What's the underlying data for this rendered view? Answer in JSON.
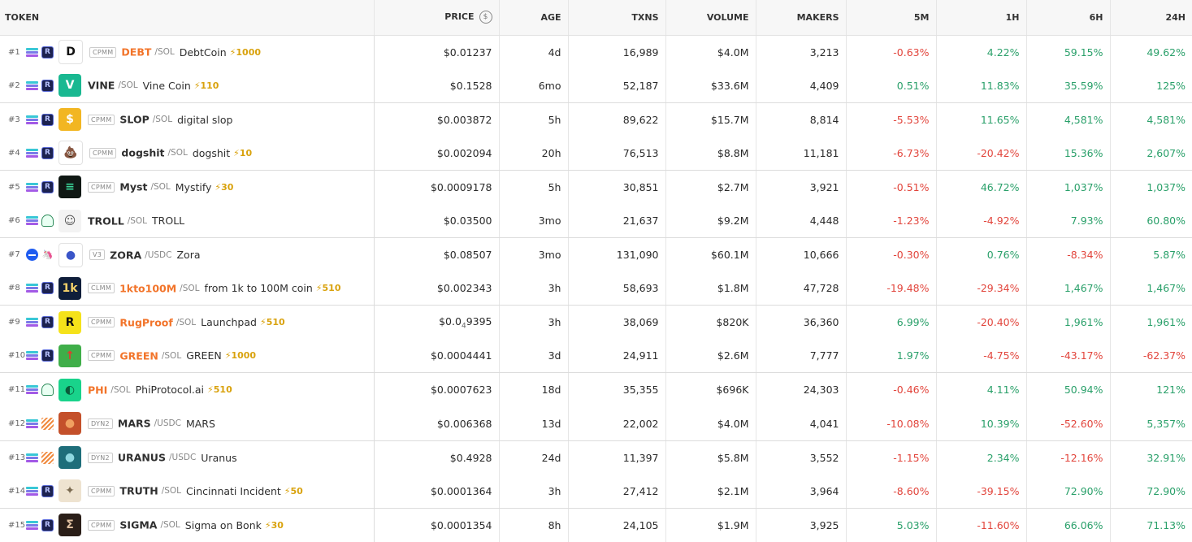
{
  "header": {
    "token": "TOKEN",
    "price": "PRICE",
    "price_icon": "$",
    "age": "AGE",
    "txns": "TXNS",
    "volume": "VOLUME",
    "makers": "MAKERS",
    "m5": "5M",
    "h1": "1H",
    "h6": "6H",
    "h24": "24H"
  },
  "colors": {
    "positive": "#2aa06a",
    "negative": "#e2453c",
    "boost": "#d9a20d",
    "highlight_symbol": "#f2742a"
  },
  "rows": [
    {
      "rank": "#1",
      "chain": "solana-icon",
      "dex": "raydium-icon",
      "icon": {
        "name": "debtcoin-logo",
        "glyph": "D",
        "bg": "#ffffff",
        "fg": "#111111"
      },
      "tag": "CPMM",
      "symbol": "DEBT",
      "symbol_highlight": true,
      "quote": "/SOL",
      "name": "DebtCoin",
      "boost": "⚡1000",
      "price": "$0.01237",
      "age": "4d",
      "txns": "16,989",
      "volume": "$4.0M",
      "makers": "3,213",
      "m5": "-0.63%",
      "h1": "4.22%",
      "h6": "59.15%",
      "h24": "49.62%"
    },
    {
      "rank": "#2",
      "chain": "solana-icon",
      "dex": "raydium-icon",
      "icon": {
        "name": "vine-logo",
        "glyph": "V",
        "bg": "#19b891",
        "fg": "#ffffff"
      },
      "tag": "",
      "symbol": "VINE",
      "symbol_highlight": false,
      "quote": "/SOL",
      "name": "Vine Coin",
      "boost": "⚡110",
      "price": "$0.1528",
      "age": "6mo",
      "txns": "52,187",
      "volume": "$33.6M",
      "makers": "4,409",
      "m5": "0.51%",
      "h1": "11.83%",
      "h6": "35.59%",
      "h24": "125%"
    },
    {
      "rank": "#3",
      "chain": "solana-icon",
      "dex": "raydium-icon",
      "icon": {
        "name": "slop-logo",
        "glyph": "$",
        "bg": "#f2b622",
        "fg": "#ffffff"
      },
      "tag": "CPMM",
      "symbol": "SLOP",
      "symbol_highlight": false,
      "quote": "/SOL",
      "name": "digital slop",
      "boost": "",
      "price": "$0.003872",
      "age": "5h",
      "txns": "89,622",
      "volume": "$15.7M",
      "makers": "8,814",
      "m5": "-5.53%",
      "h1": "11.65%",
      "h6": "4,581%",
      "h24": "4,581%"
    },
    {
      "rank": "#4",
      "chain": "solana-icon",
      "dex": "raydium-icon",
      "icon": {
        "name": "dogshit-logo",
        "glyph": "💩",
        "bg": "#ffffff",
        "fg": "#8a5a1e"
      },
      "tag": "CPMM",
      "symbol": "dogshit",
      "symbol_highlight": false,
      "quote": "/SOL",
      "name": "dogshit",
      "boost": "⚡10",
      "price": "$0.002094",
      "age": "20h",
      "txns": "76,513",
      "volume": "$8.8M",
      "makers": "11,181",
      "m5": "-6.73%",
      "h1": "-20.42%",
      "h6": "15.36%",
      "h24": "2,607%"
    },
    {
      "rank": "#5",
      "chain": "solana-icon",
      "dex": "raydium-icon",
      "icon": {
        "name": "myst-logo",
        "glyph": "≡",
        "bg": "#101814",
        "fg": "#3ad79a"
      },
      "tag": "CPMM",
      "symbol": "Myst",
      "symbol_highlight": false,
      "quote": "/SOL",
      "name": "Mystify",
      "boost": "⚡30",
      "price": "$0.0009178",
      "age": "5h",
      "txns": "30,851",
      "volume": "$2.7M",
      "makers": "3,921",
      "m5": "-0.51%",
      "h1": "46.72%",
      "h6": "1,037%",
      "h24": "1,037%"
    },
    {
      "rank": "#6",
      "chain": "solana-icon",
      "dex": "pumpswap-icon",
      "icon": {
        "name": "troll-face-logo",
        "glyph": "☺",
        "bg": "#f3f3f3",
        "fg": "#555555"
      },
      "tag": "",
      "symbol": "TROLL",
      "symbol_highlight": false,
      "quote": "/SOL",
      "name": "TROLL",
      "boost": "",
      "price": "$0.03500",
      "age": "3mo",
      "txns": "21,637",
      "volume": "$9.2M",
      "makers": "4,448",
      "m5": "-1.23%",
      "h1": "-4.92%",
      "h6": "7.93%",
      "h24": "60.80%"
    },
    {
      "rank": "#7",
      "chain": "base-icon",
      "dex": "uniswap-icon",
      "icon": {
        "name": "zora-logo",
        "glyph": "●",
        "bg": "#ffffff",
        "fg": "#3a55c8"
      },
      "tag": "V3",
      "symbol": "ZORA",
      "symbol_highlight": false,
      "quote": "/USDC",
      "name": "Zora",
      "boost": "",
      "price": "$0.08507",
      "age": "3mo",
      "txns": "131,090",
      "volume": "$60.1M",
      "makers": "10,666",
      "m5": "-0.30%",
      "h1": "0.76%",
      "h6": "-8.34%",
      "h24": "5.87%"
    },
    {
      "rank": "#8",
      "chain": "solana-icon",
      "dex": "raydium-icon",
      "icon": {
        "name": "1kto100m-logo",
        "glyph": "1k",
        "bg": "#0f1e3a",
        "fg": "#f5d36a"
      },
      "tag": "CLMM",
      "symbol": "1kto100M",
      "symbol_highlight": true,
      "quote": "/SOL",
      "name": "from 1k to 100M coin",
      "boost": "⚡510",
      "price": "$0.002343",
      "age": "3h",
      "txns": "58,693",
      "volume": "$1.8M",
      "makers": "47,728",
      "m5": "-19.48%",
      "h1": "-29.34%",
      "h6": "1,467%",
      "h24": "1,467%"
    },
    {
      "rank": "#9",
      "chain": "solana-icon",
      "dex": "raydium-icon",
      "icon": {
        "name": "rugproof-logo",
        "glyph": "R",
        "bg": "#f5e21a",
        "fg": "#111111"
      },
      "tag": "CPMM",
      "symbol": "RugProof",
      "symbol_highlight": true,
      "quote": "/SOL",
      "name": "Launchpad",
      "boost": "⚡510",
      "price_parts": {
        "head": "$0.0",
        "sub": "4",
        "tail": "9395"
      },
      "age": "3h",
      "txns": "38,069",
      "volume": "$820K",
      "makers": "36,360",
      "m5": "6.99%",
      "h1": "-20.40%",
      "h6": "1,961%",
      "h24": "1,961%"
    },
    {
      "rank": "#10",
      "chain": "solana-icon",
      "dex": "raydium-icon",
      "icon": {
        "name": "green-logo",
        "glyph": "↑",
        "bg": "#3fae49",
        "fg": "#e23b2e"
      },
      "tag": "CPMM",
      "symbol": "GREEN",
      "symbol_highlight": true,
      "quote": "/SOL",
      "name": "GREEN",
      "boost": "⚡1000",
      "price": "$0.0004441",
      "age": "3d",
      "txns": "24,911",
      "volume": "$2.6M",
      "makers": "7,777",
      "m5": "1.97%",
      "h1": "-4.75%",
      "h6": "-43.17%",
      "h24": "-62.37%"
    },
    {
      "rank": "#11",
      "chain": "solana-icon",
      "dex": "pumpswap-icon",
      "icon": {
        "name": "phi-logo",
        "glyph": "◐",
        "bg": "#19d38b",
        "fg": "#0b5a3a"
      },
      "tag": "",
      "symbol": "PHI",
      "symbol_highlight": true,
      "quote": "/SOL",
      "name": "PhiProtocol.ai",
      "boost": "⚡510",
      "price": "$0.0007623",
      "age": "18d",
      "txns": "35,355",
      "volume": "$696K",
      "makers": "24,303",
      "m5": "-0.46%",
      "h1": "4.11%",
      "h6": "50.94%",
      "h24": "121%"
    },
    {
      "rank": "#12",
      "chain": "solana-icon",
      "dex": "meteora-icon",
      "icon": {
        "name": "mars-logo",
        "glyph": "●",
        "bg": "#c4502a",
        "fg": "#f0a060"
      },
      "tag": "DYN2",
      "symbol": "MARS",
      "symbol_highlight": false,
      "quote": "/USDC",
      "name": "MARS",
      "boost": "",
      "price": "$0.006368",
      "age": "13d",
      "txns": "22,002",
      "volume": "$4.0M",
      "makers": "4,041",
      "m5": "-10.08%",
      "h1": "10.39%",
      "h6": "-52.60%",
      "h24": "5,357%"
    },
    {
      "rank": "#13",
      "chain": "solana-icon",
      "dex": "meteora-icon",
      "icon": {
        "name": "uranus-logo",
        "glyph": "●",
        "bg": "#1e6e7a",
        "fg": "#8fd8e0"
      },
      "tag": "DYN2",
      "symbol": "URANUS",
      "symbol_highlight": false,
      "quote": "/USDC",
      "name": "Uranus",
      "boost": "",
      "price": "$0.4928",
      "age": "24d",
      "txns": "11,397",
      "volume": "$5.8M",
      "makers": "3,552",
      "m5": "-1.15%",
      "h1": "2.34%",
      "h6": "-12.16%",
      "h24": "32.91%"
    },
    {
      "rank": "#14",
      "chain": "solana-icon",
      "dex": "raydium-icon",
      "icon": {
        "name": "truth-logo",
        "glyph": "✦",
        "bg": "#eee3d0",
        "fg": "#7a6a50"
      },
      "tag": "CPMM",
      "symbol": "TRUTH",
      "symbol_highlight": false,
      "quote": "/SOL",
      "name": "Cincinnati Incident",
      "boost": "⚡50",
      "price": "$0.0001364",
      "age": "3h",
      "txns": "27,412",
      "volume": "$2.1M",
      "makers": "3,964",
      "m5": "-8.60%",
      "h1": "-39.15%",
      "h6": "72.90%",
      "h24": "72.90%"
    },
    {
      "rank": "#15",
      "chain": "solana-icon",
      "dex": "raydium-icon",
      "icon": {
        "name": "sigma-logo",
        "glyph": "Σ",
        "bg": "#2a1e18",
        "fg": "#e0c0a0"
      },
      "tag": "CPMM",
      "symbol": "SIGMA",
      "symbol_highlight": false,
      "quote": "/SOL",
      "name": "Sigma on Bonk",
      "boost": "⚡30",
      "price": "$0.0001354",
      "age": "8h",
      "txns": "24,105",
      "volume": "$1.9M",
      "makers": "3,925",
      "m5": "5.03%",
      "h1": "-11.60%",
      "h6": "66.06%",
      "h24": "71.13%"
    }
  ]
}
